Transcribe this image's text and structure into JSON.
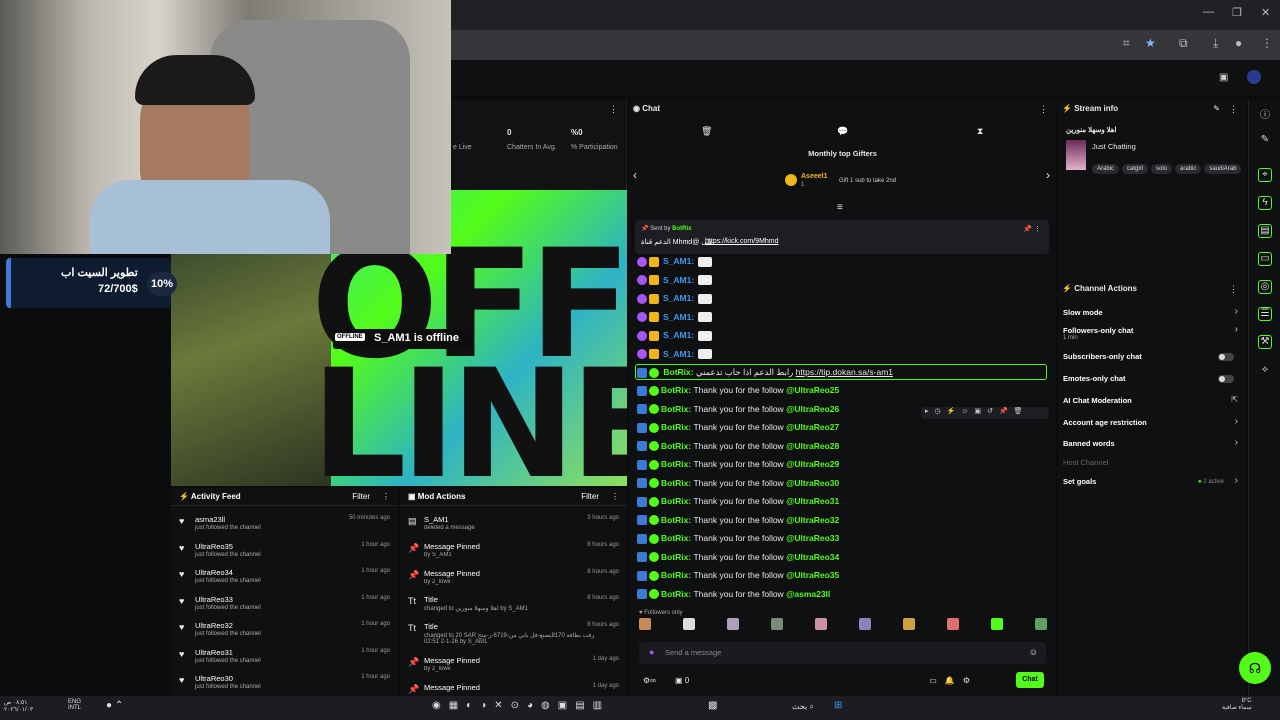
{
  "browser": {
    "win_minimize": "—",
    "win_restore": "❐",
    "win_close": "✕"
  },
  "overlay": {
    "goal_title": "تطوير السيت اب",
    "goal_amount": "72/700$",
    "goal_percent": "10%"
  },
  "stage": {
    "top_text": "OFF-",
    "bottom_text": "LINE",
    "badge": "OFFLINE",
    "offline_message": "S_AM1 is offline"
  },
  "stats": {
    "label_live": "e Live",
    "chatters_value": "0",
    "chatters_label": "Chatters In Avg.",
    "participation_value": "%0",
    "participation_label": "% Participation"
  },
  "activity": {
    "title": "Activity Feed",
    "filter": "Filter",
    "items": [
      {
        "name": "asma23ll",
        "sub": "just followed the channel",
        "time": "50 minutes ago"
      },
      {
        "name": "UltraReo35",
        "sub": "just followed the channel",
        "time": "1 hour ago"
      },
      {
        "name": "UltraReo34",
        "sub": "just followed the channel",
        "time": "1 hour ago"
      },
      {
        "name": "UltraReo33",
        "sub": "just followed the channel",
        "time": "1 hour ago"
      },
      {
        "name": "UltraReo32",
        "sub": "just followed the channel",
        "time": "1 hour ago"
      },
      {
        "name": "UltraReo31",
        "sub": "just followed the channel",
        "time": "1 hour ago"
      },
      {
        "name": "UltraReo30",
        "sub": "just followed the channel",
        "time": "1 hour ago"
      }
    ]
  },
  "mod": {
    "title": "Mod Actions",
    "filter": "Filter",
    "items": [
      {
        "name": "S_AM1",
        "sub": "deleted a message",
        "time": "3 hours ago"
      },
      {
        "name": "Message Pinned",
        "sub": "by S_AM1",
        "time": "8 hours ago"
      },
      {
        "name": "Message Pinned",
        "sub": "by 2_lowx",
        "time": "8 hours ago"
      },
      {
        "name": "Title",
        "sub": "changed to اهلا وسهلا منورين by S_AM1",
        "time": "8 hours ago"
      },
      {
        "name": "Title",
        "sub": "changed to 20 SAR شراء الفرقت بطاقة 8170يصنع-فل بايي من-6719-ر-متح",
        "sub2": "02:51 2-1-26 by S_AM1",
        "time": "8 hours ago"
      },
      {
        "name": "Message Pinned",
        "sub": "by 2_lowx",
        "time": "1 day ago"
      },
      {
        "name": "Message Pinned",
        "sub": "",
        "time": "1 day ago"
      }
    ]
  },
  "chat": {
    "title": "Chat",
    "gifters_title": "Monthly top Gifters",
    "gifter_name": "Aseeel1",
    "gifter_count": "1",
    "gift_note": "Gift 1 sub to take 2nd",
    "pinned_label": "Sent by",
    "pinned_user": "BotRix",
    "pinned_text": "الدعم قناة Mhmd@ على",
    "pinned_link": "https://kick.com/9Mhmd",
    "sam_user": "S_AM1:",
    "tip_user": "BotRix:",
    "tip_text": "رابط الدعم اذا حاب تدعمني",
    "tip_link": "https://tip.dokan.sa/s-am1",
    "follow_user": "BotRix:",
    "follow_text": "Thank you for the follow",
    "follow_mentions": [
      "@UltraReo25",
      "@UltraReo26",
      "@UltraReo27",
      "@UltraReo28",
      "@UltraReo29",
      "@UltraReo30",
      "@UltraReo31",
      "@UltraReo32",
      "@UltraReo33",
      "@UltraReo34",
      "@UltraReo35",
      "@asma23ll"
    ],
    "followers_only": "Followers only",
    "input_placeholder": "Send a message",
    "send_label": "Chat",
    "counter_value": "0"
  },
  "streaminfo": {
    "title": "Stream info",
    "stream_title": "اهلا وسهلا منورين",
    "category": "Just Chatting",
    "tags": [
      "Arabic",
      "catgirl",
      "solo",
      "arabic",
      "saudiArab"
    ]
  },
  "channel_actions": {
    "title": "Channel Actions",
    "items": [
      {
        "label": "Slow mode",
        "sub": ""
      },
      {
        "label": "Followers-only chat",
        "sub": "1 min"
      },
      {
        "label": "Subscribers-only chat",
        "sub": ""
      },
      {
        "label": "Emotes-only chat",
        "sub": ""
      },
      {
        "label": "AI Chat Moderation",
        "sub": ""
      },
      {
        "label": "Account age restriction",
        "sub": ""
      },
      {
        "label": "Banned words",
        "sub": ""
      },
      {
        "label": "Host Channel",
        "sub": ""
      },
      {
        "label": "Set goals",
        "sub": ""
      }
    ],
    "goals_active": "2 active"
  },
  "taskbar": {
    "time": "٠٨:٥١ ص",
    "date": "٢٠٢٦/٠١/٠٣",
    "lang": "ENG",
    "lang2": "INTL",
    "search": "بحث",
    "weather_temp": "8°C",
    "weather_desc": "سماء صافية"
  },
  "colors": {
    "accent": "#53fc18",
    "bg": "#0f1012"
  }
}
